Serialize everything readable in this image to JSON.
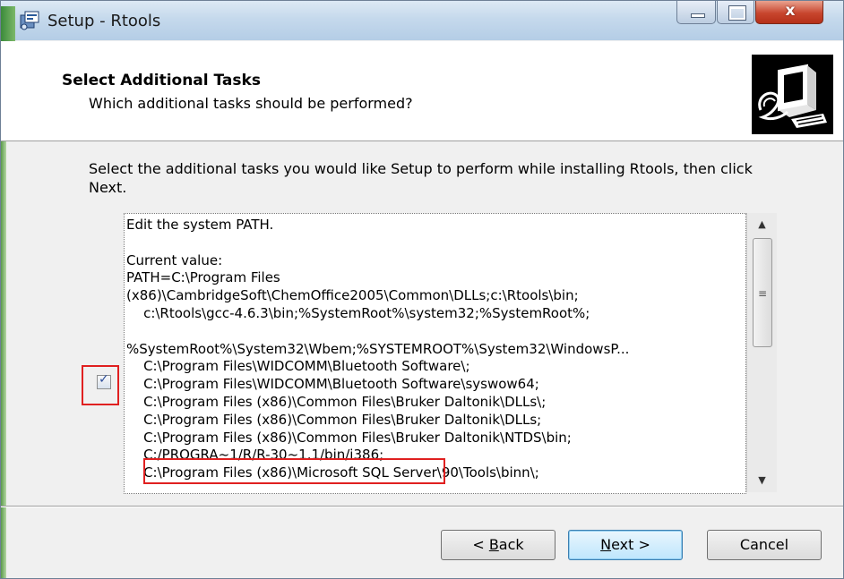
{
  "window": {
    "title": "Setup - Rtools",
    "close_glyph": "x",
    "icons": [
      "setup-app-icon",
      "minimize-icon",
      "maximize-icon",
      "close-icon",
      "installer-computer-logo-icon"
    ]
  },
  "header": {
    "title": "Select Additional Tasks",
    "subtitle": "Which additional tasks should be performed?"
  },
  "body": {
    "instruction": "Select the additional tasks you would like Setup to perform while installing Rtools, then click Next.",
    "task": {
      "checked": true,
      "lines": [
        "Edit the system PATH.",
        "",
        "Current value:",
        "PATH=C:\\Program Files",
        "(x86)\\CambridgeSoft\\ChemOffice2005\\Common\\DLLs;c:\\Rtools\\bin;",
        "    c:\\Rtools\\gcc-4.6.3\\bin;%SystemRoot%\\system32;%SystemRoot%;",
        "",
        "%SystemRoot%\\System32\\Wbem;%SYSTEMROOT%\\System32\\WindowsP...",
        "    C:\\Program Files\\WIDCOMM\\Bluetooth Software\\;",
        "    C:\\Program Files\\WIDCOMM\\Bluetooth Software\\syswow64;",
        "    C:\\Program Files (x86)\\Common Files\\Bruker Daltonik\\DLLs\\;",
        "    C:\\Program Files (x86)\\Common Files\\Bruker Daltonik\\DLLs;",
        "    C:\\Program Files (x86)\\Common Files\\Bruker Daltonik\\NTDS\\bin;",
        "    C:/PROGRA~1/R/R-30~1.1/bin/i386;",
        "    C:\\Program Files (x86)\\Microsoft SQL Server\\90\\Tools\\binn\\;"
      ]
    },
    "scrollbar": {
      "up_glyph": "▲",
      "grip_glyph": "≡",
      "down_glyph": "▼"
    },
    "colors": {
      "annotation": "#e02020",
      "accent": "#3c7fb1"
    }
  },
  "footer": {
    "back_prefix": "< ",
    "back_key": "B",
    "back_rest": "ack",
    "next_key": "N",
    "next_rest": "ext >",
    "cancel": "Cancel"
  }
}
